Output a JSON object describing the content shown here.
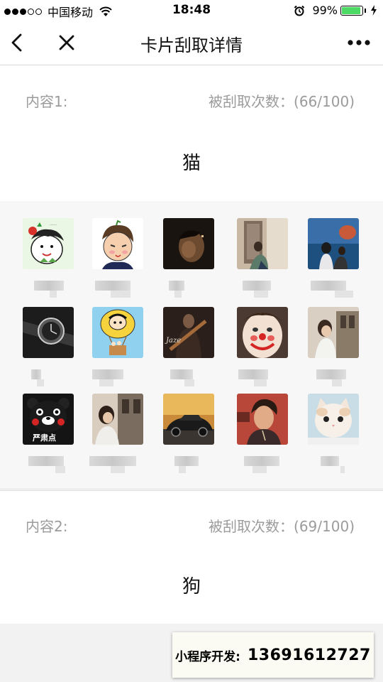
{
  "status_bar": {
    "carrier": "中国移动",
    "time": "18:48",
    "battery": "99%"
  },
  "nav": {
    "title": "卡片刮取详情",
    "back_icon": "chevron-left-icon",
    "close_icon": "close-icon",
    "more_icon": "more-dots-icon"
  },
  "content1": {
    "label": "内容1:",
    "count": "被刮取次数：(66/100)",
    "word": "猫"
  },
  "content2": {
    "label": "内容2:",
    "count": "被刮取次数：(69/100)",
    "word": "狗"
  },
  "avatars": [
    {
      "icon": "cartoon-girl-avatar"
    },
    {
      "icon": "cartoon-boy-avatar"
    },
    {
      "icon": "dark-portrait-avatar"
    },
    {
      "icon": "couple-photo-avatar"
    },
    {
      "icon": "couple-sea-avatar"
    },
    {
      "icon": "watch-photo-avatar"
    },
    {
      "icon": "cartoon-balloon-avatar"
    },
    {
      "icon": "guitar-photo-avatar"
    },
    {
      "icon": "clown-face-avatar"
    },
    {
      "icon": "girl-street-avatar"
    },
    {
      "icon": "kumamon-avatar"
    },
    {
      "icon": "girl-street-avatar-2"
    },
    {
      "icon": "sports-car-avatar"
    },
    {
      "icon": "man-portrait-avatar"
    },
    {
      "icon": "white-kitten-avatar"
    }
  ],
  "contact": {
    "label": "小程序开发:",
    "phone": "13691612727"
  }
}
